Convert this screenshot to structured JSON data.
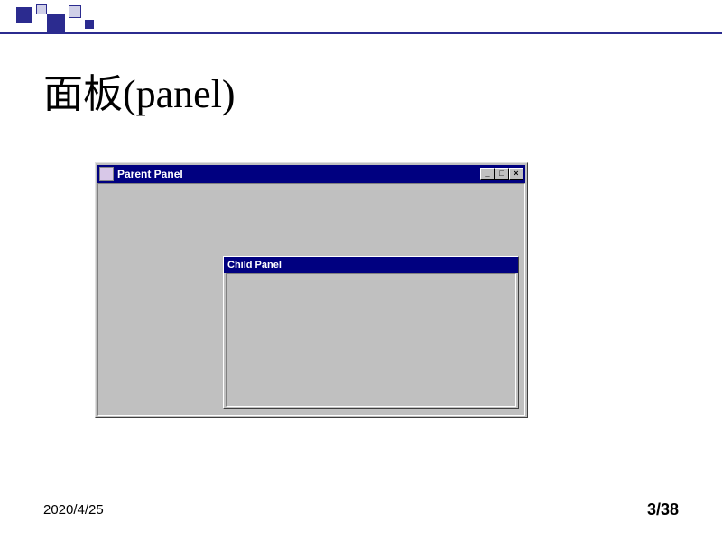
{
  "slide": {
    "title": "面板(panel)",
    "parent_window_title": "Parent Panel",
    "child_panel_title": "Child Panel"
  },
  "footer": {
    "date": "2020/4/25",
    "page": "3/38"
  },
  "controls": {
    "minimize": "_",
    "maximize": "□",
    "close": "×"
  }
}
